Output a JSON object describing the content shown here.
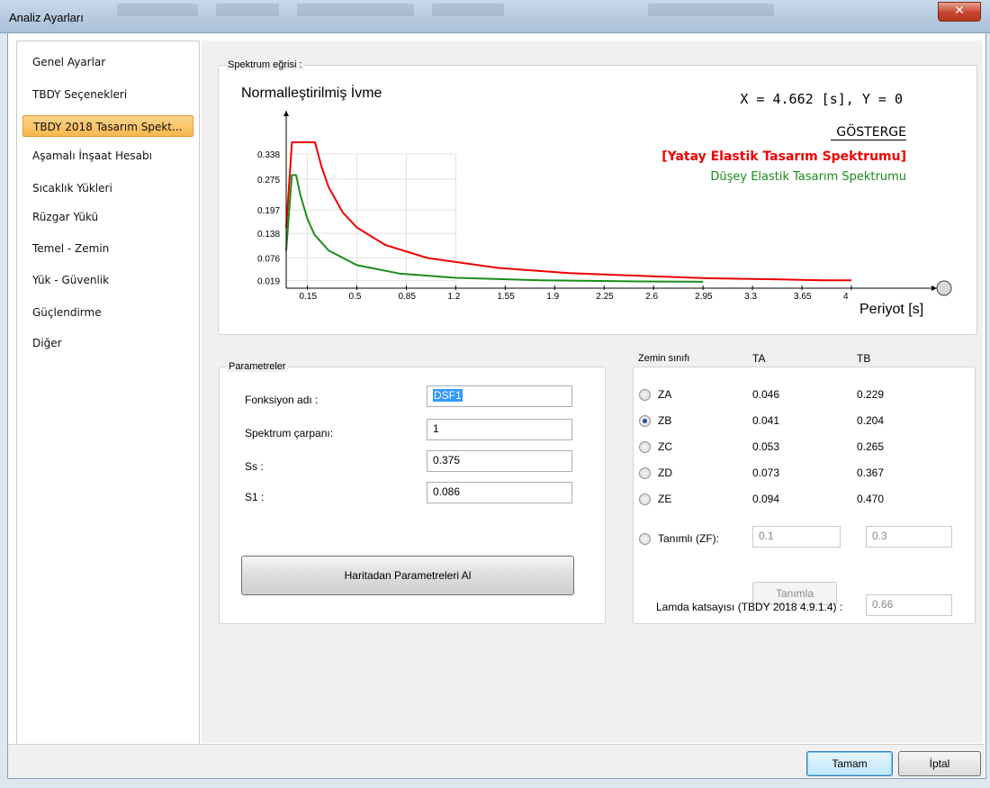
{
  "window": {
    "title": "Analiz Ayarları"
  },
  "sidebar": {
    "items": [
      {
        "label": "Genel Ayarlar"
      },
      {
        "label": "TBDY Seçenekleri"
      },
      {
        "label": "TBDY 2018 Tasarım Spekt..."
      },
      {
        "label": "Aşamalı İnşaat Hesabı"
      },
      {
        "label": "Sıcaklık Yükleri"
      },
      {
        "label": "Rüzgar Yükü"
      },
      {
        "label": "Temel - Zemin"
      },
      {
        "label": "Yük - Güvenlik"
      },
      {
        "label": "Güçlendirme"
      },
      {
        "label": "Diğer"
      }
    ],
    "active_index": 2
  },
  "spectrum": {
    "group_title": "Spektrum eğrisi :",
    "cursor_readout": "X = 4.662 [s],  Y = 0",
    "legend_title": "GÖSTERGE",
    "legend_horizontal": "[Yatay Elastik Tasarım Spektrumu]",
    "legend_vertical": "Düşey Elastik Tasarım Spektrumu",
    "colors": {
      "horizontal": "#ee0000",
      "vertical": "#1a8c1a"
    }
  },
  "chart_data": {
    "type": "line",
    "ylabel": "Normalleştirilmiş İvme",
    "xlabel": "Periyot [s]",
    "x_ticks": [
      "0.15",
      "0.5",
      "0.85",
      "1.2",
      "1.55",
      "1.9",
      "2.25",
      "2.6",
      "2.95",
      "3.3",
      "3.65",
      "4"
    ],
    "y_ticks": [
      "0.019",
      "0.076",
      "0.138",
      "0.197",
      "0.275",
      "0.338"
    ],
    "xlim": [
      0,
      4
    ],
    "ylim": [
      0,
      0.338
    ],
    "series": [
      {
        "name": "[Yatay Elastik Tasarım Spektrumu]",
        "x": [
          0.0,
          0.041,
          0.204,
          0.25,
          0.3,
          0.4,
          0.5,
          0.7,
          1.0,
          1.5,
          2.0,
          2.5,
          3.0,
          3.5,
          3.8,
          4.0
        ],
        "y": [
          0.152,
          0.375,
          0.375,
          0.306,
          0.255,
          0.191,
          0.153,
          0.109,
          0.076,
          0.051,
          0.038,
          0.031,
          0.025,
          0.022,
          0.02,
          0.02
        ]
      },
      {
        "name": "Düşey Elastik Tasarım Spektrumu",
        "x": [
          0.0,
          0.04,
          0.07,
          0.1,
          0.15,
          0.2,
          0.3,
          0.5,
          0.8,
          1.2,
          1.8,
          2.5,
          2.95
        ],
        "y": [
          0.095,
          0.285,
          0.285,
          0.235,
          0.175,
          0.135,
          0.095,
          0.058,
          0.037,
          0.026,
          0.02,
          0.017,
          0.016
        ]
      }
    ]
  },
  "params": {
    "group_title": "Parametreler",
    "function_name_label": "Fonksiyon adı :",
    "function_name_value": "DSF1",
    "multiplier_label": "Spektrum çarpanı:",
    "multiplier_value": "1",
    "ss_label": "Ss :",
    "ss_value": "0.375",
    "s1_label": "S1 :",
    "s1_value": "0.086",
    "map_button": "Haritadan Parametreleri Al"
  },
  "soil": {
    "col_class": "Zemin sınıfı",
    "col_ta": "TA",
    "col_tb": "TB",
    "rows": [
      {
        "label": "ZA",
        "ta": "0.046",
        "tb": "0.229",
        "checked": false
      },
      {
        "label": "ZB",
        "ta": "0.041",
        "tb": "0.204",
        "checked": true
      },
      {
        "label": "ZC",
        "ta": "0.053",
        "tb": "0.265",
        "checked": false
      },
      {
        "label": "ZD",
        "ta": "0.073",
        "tb": "0.367",
        "checked": false
      },
      {
        "label": "ZE",
        "ta": "0.094",
        "tb": "0.470",
        "checked": false
      }
    ],
    "custom_label": "Tanımlı (ZF):",
    "custom_ta": "0.1",
    "custom_tb": "0.3",
    "define_button": "Tanımla",
    "lambda_label": "Lamda katsayısı (TBDY 2018 4.9.1.4) :",
    "lambda_value": "0.66"
  },
  "footer": {
    "ok": "Tamam",
    "cancel": "İptal"
  }
}
